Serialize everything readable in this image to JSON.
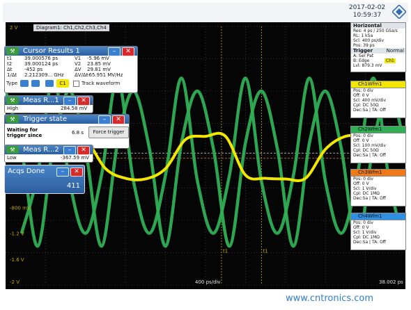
{
  "header": {
    "date": "2017-02-02",
    "time": "10:59:37"
  },
  "diagram": {
    "title": "Diagram1: Ch1,Ch2,Ch3,Ch4"
  },
  "cursor_results": {
    "title": "Cursor Results 1",
    "rows": [
      [
        "t1",
        "39.000576 ps",
        "V1",
        "-5.96 mV"
      ],
      [
        "t2",
        "39.000124 ps",
        "V2",
        "23.85 mV"
      ],
      [
        "Δt",
        "-452 ps",
        "ΔV",
        "29.81 mV"
      ],
      [
        "1/Δt",
        "2.212309... GHz",
        "ΔV/Δt",
        "-65.951 MV/Hz"
      ]
    ],
    "type_label": "Type",
    "cursor_button": "C1",
    "track_label": "Track waveform"
  },
  "meas1": {
    "title": "Meas R...1",
    "label": "High",
    "value": "284.58 mV"
  },
  "trigger_state": {
    "title": "Trigger state",
    "waiting": "Waiting for",
    "since": "trigger since",
    "elapsed": "6.8 s",
    "button": "Force trigger"
  },
  "meas2": {
    "title": "Meas R...2",
    "label": "Low",
    "value": "-367.59 mV"
  },
  "acqs": {
    "title": "Acqs Done",
    "count": "411"
  },
  "horizontal": {
    "title": "Horizontal",
    "res": "Res: 4 ps / 250 GSa/s",
    "rl": "RL: 1 kSa",
    "scl": "Scl: 400 ps/div",
    "pos": "Pos: 39 ps"
  },
  "trigger_panel": {
    "title": "Trigger",
    "mode": "Normal",
    "line1": "A:  Ser Pat",
    "line2": "B:  Edge",
    "line2_ch": "Ch1",
    "line3": "Lvl: 879.3 mV"
  },
  "channels": [
    {
      "name": "Ch1Wfm1",
      "color": "#f3e600",
      "lines": [
        "Pos: 0 div",
        "Off: 0 V",
        "Scl: 400 mV/div",
        "Cpl: DC 50Ω",
        "Dec:Sa | TA: Off"
      ]
    },
    {
      "name": "Ch2Wfm1",
      "color": "#2fae55",
      "lines": [
        "Pos: 0 div",
        "Off: 0 V",
        "Scl: 100 mV/div",
        "Cpl: DC 50Ω",
        "Dec:Sa | TA: Off"
      ]
    },
    {
      "name": "Ch3Wfm1",
      "color": "#f07a1a",
      "lines": [
        "Pos: 0 div",
        "Off: 0 V",
        "Scl: 1 V/div",
        "Cpl: DC 1MΩ",
        "Dec:Sa | TA: Off"
      ]
    },
    {
      "name": "Ch4Wfm1",
      "color": "#2f8fe0",
      "lines": [
        "Pos: 0 div",
        "Off: 0 V",
        "Scl: 1 V/div",
        "Cpl: DC 1MΩ",
        "Dec:Sa | TA: Off"
      ]
    }
  ],
  "axis": {
    "top_label": "2 V",
    "bottom_label": "-2 V",
    "labels": [
      "-400 mV",
      "-800 mV",
      "-1.2 V",
      "-1.6 V"
    ],
    "timebase": "400 ps/div",
    "end_time": "38.002 ps",
    "cursor_tags": [
      "t1",
      "t1"
    ]
  },
  "watermark": "www.cntronics.com",
  "colors": {
    "ch1": "#f3e600",
    "ch2": "#2fae55",
    "ch3": "#f07a1a",
    "ch4": "#2f8fe0",
    "panel_blue": "#3a6fb0",
    "grid": "#5a5a5a"
  },
  "chart_data": {
    "type": "line",
    "xlabel": "",
    "ylabel": "",
    "xlim": [
      0,
      10
    ],
    "ylim": [
      -2,
      2
    ],
    "grid": true,
    "series": [
      {
        "name": "Ch1Wfm1",
        "x": [
          0,
          0.5,
          1.0,
          1.5,
          2.0,
          2.5,
          3.0,
          3.5,
          4.0,
          4.5,
          5.0,
          5.5,
          6.0,
          6.5,
          7.0,
          7.5,
          8.0,
          8.5,
          9.0,
          9.5,
          10.0
        ],
        "values": [
          0.05,
          0.1,
          0.3,
          0.3,
          0.25,
          -0.2,
          -0.35,
          -0.36,
          -0.2,
          0.25,
          0.3,
          0.3,
          -0.3,
          -0.35,
          -0.36,
          -0.35,
          0.1,
          0.3,
          0.3,
          0.3,
          0.3
        ]
      },
      {
        "name": "Ch2Wfm1",
        "x": [
          0,
          0.4,
          0.8,
          1.2,
          1.6,
          2.0,
          2.4,
          2.8,
          3.2,
          3.6,
          4.0,
          4.4,
          4.8,
          5.2,
          5.6,
          6.0,
          6.4,
          6.8,
          7.2,
          7.6,
          8.0,
          8.4,
          8.8,
          9.2,
          9.6,
          10.0
        ],
        "values": [
          1.0,
          0.1,
          -1.4,
          0.2,
          1.0,
          0.1,
          -1.4,
          0.2,
          1.0,
          0.1,
          -1.4,
          0.2,
          1.0,
          0.1,
          -1.4,
          0.2,
          1.0,
          0.1,
          -1.4,
          0.2,
          1.0,
          0.1,
          -1.4,
          0.2,
          1.0,
          0.1
        ]
      }
    ]
  }
}
